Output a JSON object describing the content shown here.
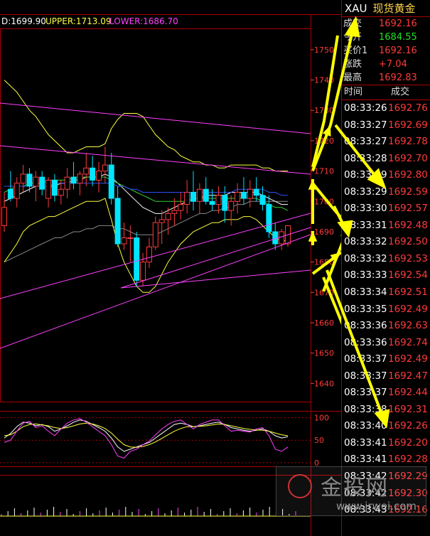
{
  "header": {
    "d_label": "D:1699.90",
    "upper_label": "UPPER:1713.09",
    "lower_label": "LOWER:1686.70"
  },
  "panel": {
    "code": "XAU",
    "name": "现货黄金",
    "quotes": [
      {
        "label": "成交",
        "value": "1692.16",
        "color": "red"
      },
      {
        "label": "今开",
        "value": "1684.55",
        "color": "green"
      },
      {
        "label": "买价1",
        "value": "1692.16",
        "color": "red"
      },
      {
        "label": "涨跌",
        "value": "+7.04",
        "color": "red"
      },
      {
        "label": "最高",
        "value": "1692.83",
        "color": "red"
      }
    ],
    "table_headers": {
      "time": "时间",
      "trade": "成交"
    },
    "ticks": [
      {
        "time": "08:33:26",
        "price": "1692.76"
      },
      {
        "time": "08:33:27",
        "price": "1692.69"
      },
      {
        "time": "08:33:27",
        "price": "1692.78"
      },
      {
        "time": "08:33:28",
        "price": "1692.70"
      },
      {
        "time": "08:33:29",
        "price": "1692.80"
      },
      {
        "time": "08:33:29",
        "price": "1692.59"
      },
      {
        "time": "08:33:30",
        "price": "1692.57"
      },
      {
        "time": "08:33:31",
        "price": "1692.48"
      },
      {
        "time": "08:33:32",
        "price": "1692.50"
      },
      {
        "time": "08:33:32",
        "price": "1692.53"
      },
      {
        "time": "08:33:33",
        "price": "1692.54"
      },
      {
        "time": "08:33:34",
        "price": "1692.51"
      },
      {
        "time": "08:33:35",
        "price": "1692.49"
      },
      {
        "time": "08:33:36",
        "price": "1692.63"
      },
      {
        "time": "08:33:36",
        "price": "1692.74"
      },
      {
        "time": "08:33:37",
        "price": "1692.49"
      },
      {
        "time": "08:33:37",
        "price": "1692.47"
      },
      {
        "time": "08:33:37",
        "price": "1692.44"
      },
      {
        "time": "08:33:38",
        "price": "1692.31"
      },
      {
        "time": "08:33:40",
        "price": "1692.26"
      },
      {
        "time": "08:33:41",
        "price": "1692.20"
      },
      {
        "time": "08:33:41",
        "price": "1692.28"
      },
      {
        "time": "08:33:42",
        "price": "1692.29"
      },
      {
        "time": "08:33:42",
        "price": "1692.30"
      },
      {
        "time": "08:33:43",
        "price": "1692.16"
      }
    ]
  },
  "watermark": {
    "text": "金投网",
    "url": "www.jrwei.com"
  },
  "colors": {
    "up": "#ff3b3b",
    "down": "#00e5ff",
    "grid": "#aa0000",
    "axis": "#ff3b3b",
    "upper": "#ffff40",
    "lower": "#ff40ff",
    "mid": "#ffffff"
  },
  "chart_data": [
    {
      "type": "candlestick",
      "y_ticks": [
        1640,
        1650,
        1660,
        1670,
        1680,
        1690,
        1700,
        1710,
        1720,
        1730,
        1740,
        1750
      ],
      "ylim": [
        1634,
        1757
      ],
      "candles": [
        {
          "o": 1692,
          "h": 1703,
          "l": 1690,
          "c": 1698
        },
        {
          "o": 1704,
          "h": 1710,
          "l": 1700,
          "c": 1701
        },
        {
          "o": 1701,
          "h": 1708,
          "l": 1698,
          "c": 1706
        },
        {
          "o": 1706,
          "h": 1712,
          "l": 1703,
          "c": 1709
        },
        {
          "o": 1709,
          "h": 1711,
          "l": 1703,
          "c": 1705
        },
        {
          "o": 1705,
          "h": 1710,
          "l": 1700,
          "c": 1708
        },
        {
          "o": 1708,
          "h": 1710,
          "l": 1702,
          "c": 1704
        },
        {
          "o": 1701,
          "h": 1708,
          "l": 1698,
          "c": 1707
        },
        {
          "o": 1707,
          "h": 1709,
          "l": 1700,
          "c": 1702
        },
        {
          "o": 1702,
          "h": 1707,
          "l": 1699,
          "c": 1704
        },
        {
          "o": 1704,
          "h": 1711,
          "l": 1701,
          "c": 1708
        },
        {
          "o": 1708,
          "h": 1713,
          "l": 1704,
          "c": 1706
        },
        {
          "o": 1706,
          "h": 1710,
          "l": 1702,
          "c": 1709
        },
        {
          "o": 1709,
          "h": 1716,
          "l": 1705,
          "c": 1711
        },
        {
          "o": 1711,
          "h": 1715,
          "l": 1705,
          "c": 1707
        },
        {
          "o": 1707,
          "h": 1713,
          "l": 1703,
          "c": 1710
        },
        {
          "o": 1710,
          "h": 1718,
          "l": 1706,
          "c": 1712
        },
        {
          "o": 1712,
          "h": 1716,
          "l": 1699,
          "c": 1701
        },
        {
          "o": 1701,
          "h": 1705,
          "l": 1685,
          "c": 1686
        },
        {
          "o": 1686,
          "h": 1693,
          "l": 1684,
          "c": 1688
        },
        {
          "o": 1688,
          "h": 1692,
          "l": 1680,
          "c": 1688
        },
        {
          "o": 1688,
          "h": 1690,
          "l": 1672,
          "c": 1674
        },
        {
          "o": 1674,
          "h": 1683,
          "l": 1672,
          "c": 1680
        },
        {
          "o": 1680,
          "h": 1688,
          "l": 1678,
          "c": 1685
        },
        {
          "o": 1685,
          "h": 1695,
          "l": 1684,
          "c": 1693
        },
        {
          "o": 1693,
          "h": 1697,
          "l": 1686,
          "c": 1694
        },
        {
          "o": 1694,
          "h": 1698,
          "l": 1689,
          "c": 1696
        },
        {
          "o": 1696,
          "h": 1701,
          "l": 1692,
          "c": 1697
        },
        {
          "o": 1697,
          "h": 1703,
          "l": 1694,
          "c": 1699
        },
        {
          "o": 1699,
          "h": 1707,
          "l": 1696,
          "c": 1703
        },
        {
          "o": 1703,
          "h": 1710,
          "l": 1697,
          "c": 1700
        },
        {
          "o": 1700,
          "h": 1706,
          "l": 1696,
          "c": 1704
        },
        {
          "o": 1704,
          "h": 1708,
          "l": 1699,
          "c": 1700
        },
        {
          "o": 1700,
          "h": 1704,
          "l": 1697,
          "c": 1699
        },
        {
          "o": 1699,
          "h": 1705,
          "l": 1696,
          "c": 1702
        },
        {
          "o": 1702,
          "h": 1705,
          "l": 1693,
          "c": 1697
        },
        {
          "o": 1697,
          "h": 1702,
          "l": 1692,
          "c": 1700
        },
        {
          "o": 1700,
          "h": 1706,
          "l": 1696,
          "c": 1703
        },
        {
          "o": 1703,
          "h": 1708,
          "l": 1699,
          "c": 1701
        },
        {
          "o": 1701,
          "h": 1707,
          "l": 1698,
          "c": 1704
        },
        {
          "o": 1704,
          "h": 1708,
          "l": 1700,
          "c": 1702
        },
        {
          "o": 1702,
          "h": 1705,
          "l": 1697,
          "c": 1699
        },
        {
          "o": 1699,
          "h": 1702,
          "l": 1688,
          "c": 1690
        },
        {
          "o": 1690,
          "h": 1693,
          "l": 1684,
          "c": 1686
        },
        {
          "o": 1686,
          "h": 1691,
          "l": 1684,
          "c": 1690
        },
        {
          "o": 1686,
          "h": 1692,
          "l": 1685,
          "c": 1692
        }
      ],
      "upper_band": [
        1740,
        1738,
        1736,
        1733,
        1730,
        1728,
        1725,
        1722,
        1720,
        1718,
        1716,
        1716,
        1717,
        1718,
        1718,
        1718,
        1719,
        1724,
        1727,
        1729,
        1729,
        1729,
        1728,
        1725,
        1722,
        1720,
        1718,
        1717,
        1715,
        1714,
        1713,
        1713,
        1712,
        1712,
        1711,
        1711,
        1712,
        1712,
        1712,
        1712,
        1712,
        1711,
        1711,
        1710,
        1710,
        1710
      ],
      "lower_band": [
        1680,
        1683,
        1686,
        1690,
        1692,
        1693,
        1694,
        1695,
        1695,
        1696,
        1697,
        1698,
        1699,
        1700,
        1700,
        1700,
        1701,
        1694,
        1686,
        1680,
        1676,
        1672,
        1670,
        1670,
        1672,
        1676,
        1680,
        1683,
        1686,
        1688,
        1690,
        1691,
        1692,
        1693,
        1693,
        1694,
        1694,
        1694,
        1695,
        1695,
        1694,
        1692,
        1690,
        1688,
        1687,
        1687
      ],
      "mid_band": [
        1700,
        1701,
        1702,
        1703,
        1704,
        1705,
        1705,
        1705,
        1705,
        1706,
        1706,
        1707,
        1707,
        1708,
        1708,
        1708,
        1709,
        1708,
        1706,
        1704,
        1702,
        1700,
        1698,
        1697,
        1696,
        1696,
        1697,
        1698,
        1699,
        1700,
        1701,
        1701,
        1702,
        1702,
        1702,
        1702,
        1703,
        1703,
        1703,
        1703,
        1703,
        1702,
        1701,
        1700,
        1699,
        1699
      ],
      "ma_green": [
        1703,
        1704,
        1705,
        1705,
        1706,
        1706,
        1706,
        1707,
        1707,
        1707,
        1707,
        1708,
        1708,
        1708,
        1708,
        1708,
        1708,
        1707,
        1706,
        1705,
        1704,
        1703,
        1702,
        1701,
        1700,
        1700,
        1700,
        1700,
        1700,
        1700,
        1701,
        1701,
        1701,
        1701,
        1701,
        1701,
        1701,
        1701,
        1701,
        1701,
        1701,
        1700,
        1699,
        1698,
        1698,
        1697
      ],
      "ma_blue": [
        1705,
        1705,
        1705,
        1705,
        1705,
        1705,
        1705,
        1705,
        1706,
        1706,
        1706,
        1706,
        1706,
        1706,
        1706,
        1706,
        1706,
        1706,
        1705,
        1705,
        1704,
        1704,
        1703,
        1703,
        1703,
        1703,
        1703,
        1703,
        1703,
        1703,
        1703,
        1703,
        1703,
        1703,
        1703,
        1703,
        1703,
        1704,
        1704,
        1704,
        1704,
        1704,
        1703,
        1703,
        1702,
        1702
      ],
      "ma_gray": [
        1680,
        1681,
        1682,
        1683,
        1684,
        1685,
        1686,
        1687,
        1688,
        1688,
        1689,
        1690,
        1690,
        1691,
        1691,
        1692,
        1692,
        1692,
        1691,
        1691,
        1690,
        1689,
        1689,
        1689,
        1689,
        1690,
        1691,
        1692,
        1693,
        1694,
        1695,
        1696,
        1696,
        1697,
        1697,
        1698,
        1698,
        1699,
        1699,
        1700,
        1700,
        1700,
        1700,
        1700,
        1700,
        1700
      ]
    },
    {
      "type": "line",
      "y_ticks": [
        0,
        50,
        100
      ],
      "ylim": [
        -5,
        112
      ],
      "series": [
        {
          "values": [
            55,
            65,
            80,
            90,
            88,
            82,
            85,
            80,
            70,
            75,
            82,
            90,
            95,
            92,
            85,
            78,
            70,
            55,
            35,
            25,
            30,
            35,
            40,
            45,
            55,
            65,
            75,
            85,
            88,
            85,
            80,
            82,
            85,
            88,
            90,
            85,
            78,
            75,
            72,
            70,
            72,
            75,
            70,
            60,
            55,
            58
          ]
        },
        {
          "values": [
            60,
            62,
            70,
            80,
            85,
            86,
            84,
            82,
            78,
            76,
            78,
            82,
            86,
            88,
            86,
            82,
            76,
            66,
            52,
            40,
            35,
            34,
            36,
            40,
            46,
            54,
            62,
            70,
            76,
            80,
            80,
            81,
            82,
            84,
            86,
            85,
            82,
            79,
            76,
            74,
            73,
            72,
            70,
            66,
            62,
            60
          ]
        },
        {
          "values": [
            45,
            50,
            70,
            88,
            92,
            78,
            82,
            70,
            60,
            75,
            88,
            95,
            98,
            90,
            80,
            70,
            60,
            40,
            15,
            10,
            25,
            30,
            40,
            48,
            62,
            75,
            85,
            92,
            95,
            85,
            75,
            85,
            90,
            95,
            95,
            82,
            70,
            72,
            70,
            68,
            75,
            78,
            60,
            30,
            25,
            35
          ]
        }
      ]
    }
  ]
}
